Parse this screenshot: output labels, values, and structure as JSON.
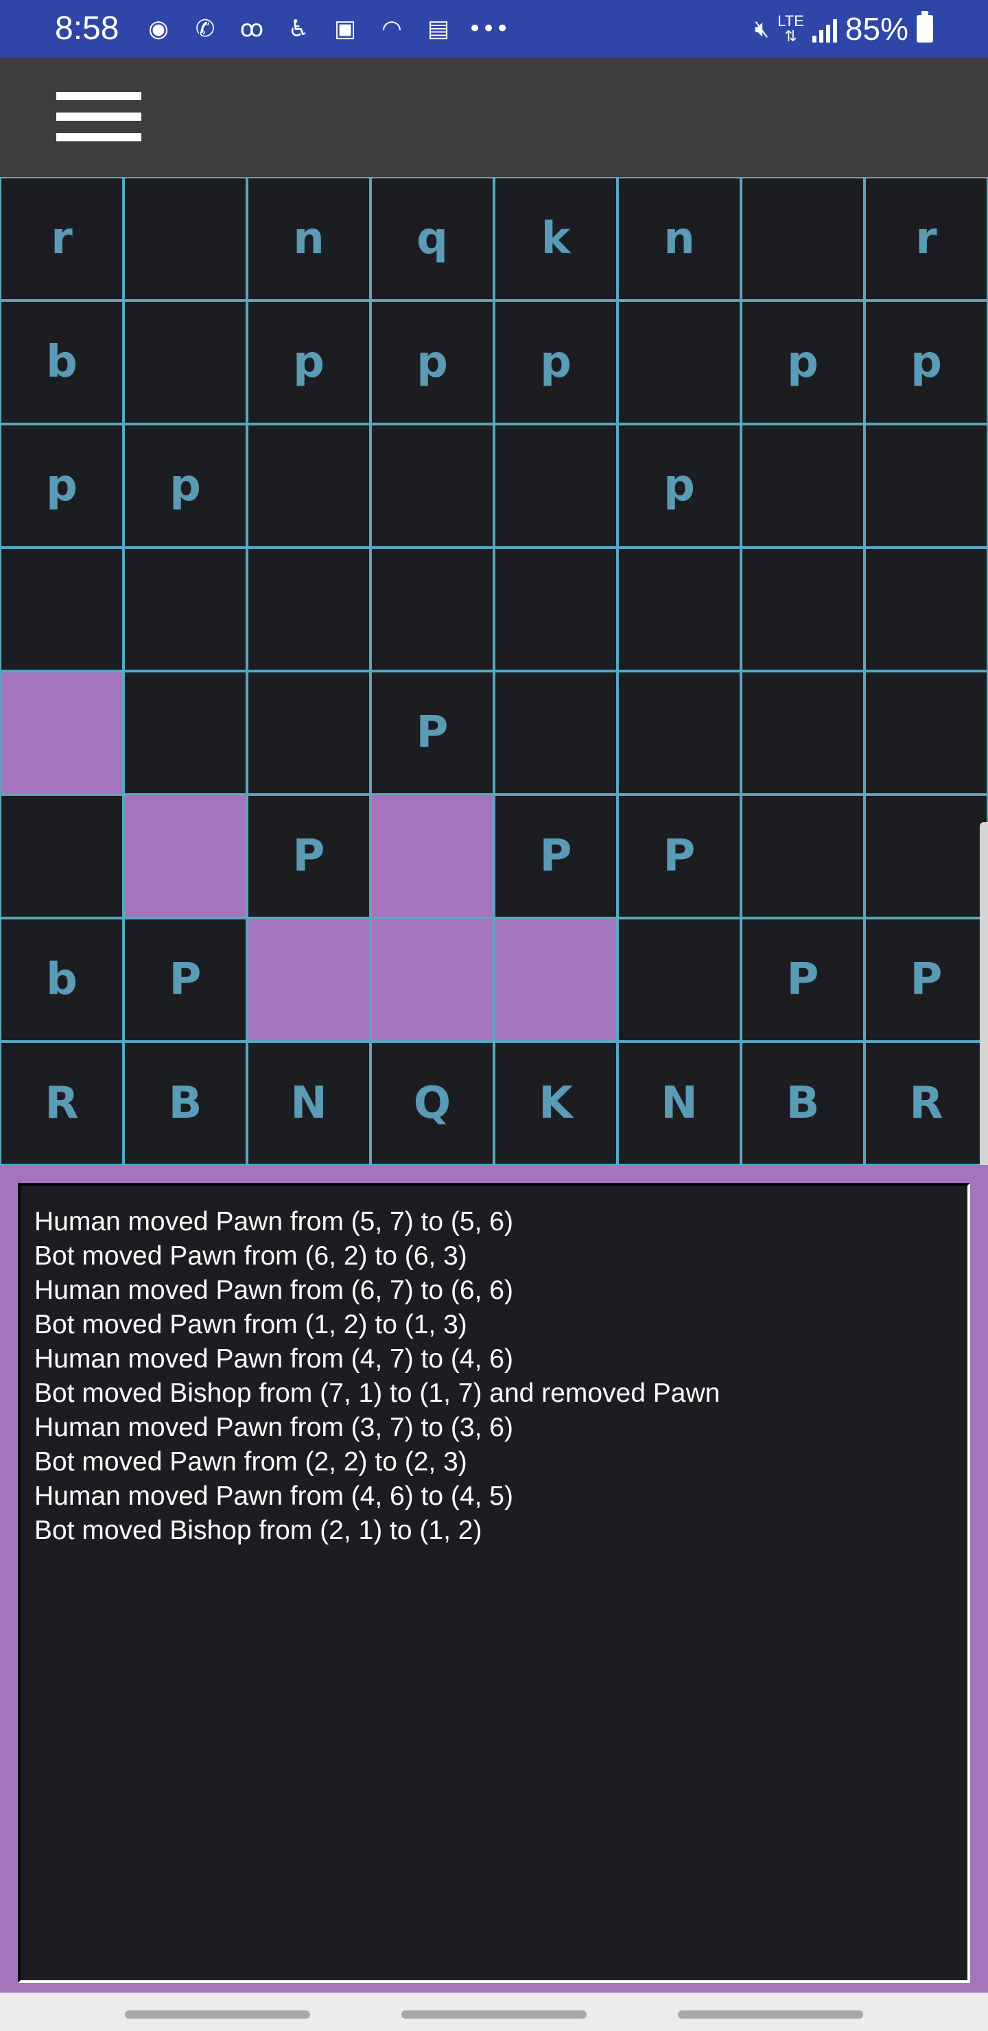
{
  "status_bar": {
    "time": "8:58",
    "left_icons": [
      "spotify-icon",
      "whatsapp-icon",
      "voicemail-icon",
      "accessibility-icon",
      "gallery-icon",
      "wifi-icon",
      "clapper-icon",
      "more-dots-icon"
    ],
    "lte": "LTE",
    "battery_percent": "85%"
  },
  "toolbar": {
    "menu_icon": "hamburger-menu-icon"
  },
  "board": {
    "rows": [
      [
        "r",
        "",
        "n",
        "q",
        "k",
        "n",
        "",
        "r"
      ],
      [
        "b",
        "",
        "p",
        "p",
        "p",
        "",
        "p",
        "p"
      ],
      [
        "p",
        "p",
        "",
        "",
        "",
        "p",
        "",
        ""
      ],
      [
        "",
        "",
        "",
        "",
        "",
        "",
        "",
        ""
      ],
      [
        "",
        "",
        "",
        "P",
        "",
        "",
        "",
        ""
      ],
      [
        "",
        "",
        "P",
        "",
        "P",
        "P",
        "",
        ""
      ],
      [
        "b",
        "P",
        "",
        "",
        "",
        "",
        "P",
        "P"
      ],
      [
        "R",
        "B",
        "N",
        "Q",
        "K",
        "N",
        "B",
        "R"
      ]
    ],
    "highlighted": [
      [
        4,
        0
      ],
      [
        5,
        1
      ],
      [
        5,
        3
      ],
      [
        6,
        2
      ],
      [
        6,
        3
      ],
      [
        6,
        4
      ]
    ],
    "colors": {
      "cell_background": "#1c1d21",
      "grid_line": "#5aa6c0",
      "piece": "#5b9bb6",
      "highlight": "#a474bd"
    }
  },
  "log": {
    "lines": [
      "Human moved Pawn from (5, 7) to (5, 6)",
      "Bot moved Pawn from (6, 2) to (6, 3)",
      "Human moved Pawn from (6, 7) to (6, 6)",
      "Bot moved Pawn from (1, 2) to (1, 3)",
      "Human moved Pawn from (4, 7) to (4, 6)",
      "Bot moved Bishop from (7, 1) to (1, 7) and removed Pawn",
      "Human moved Pawn from (3, 7) to (3, 6)",
      "Bot moved Pawn from (2, 2) to (2, 3)",
      "Human moved Pawn from (4, 6) to (4, 5)",
      "Bot moved Bishop from (2, 1) to (1, 2)"
    ]
  }
}
